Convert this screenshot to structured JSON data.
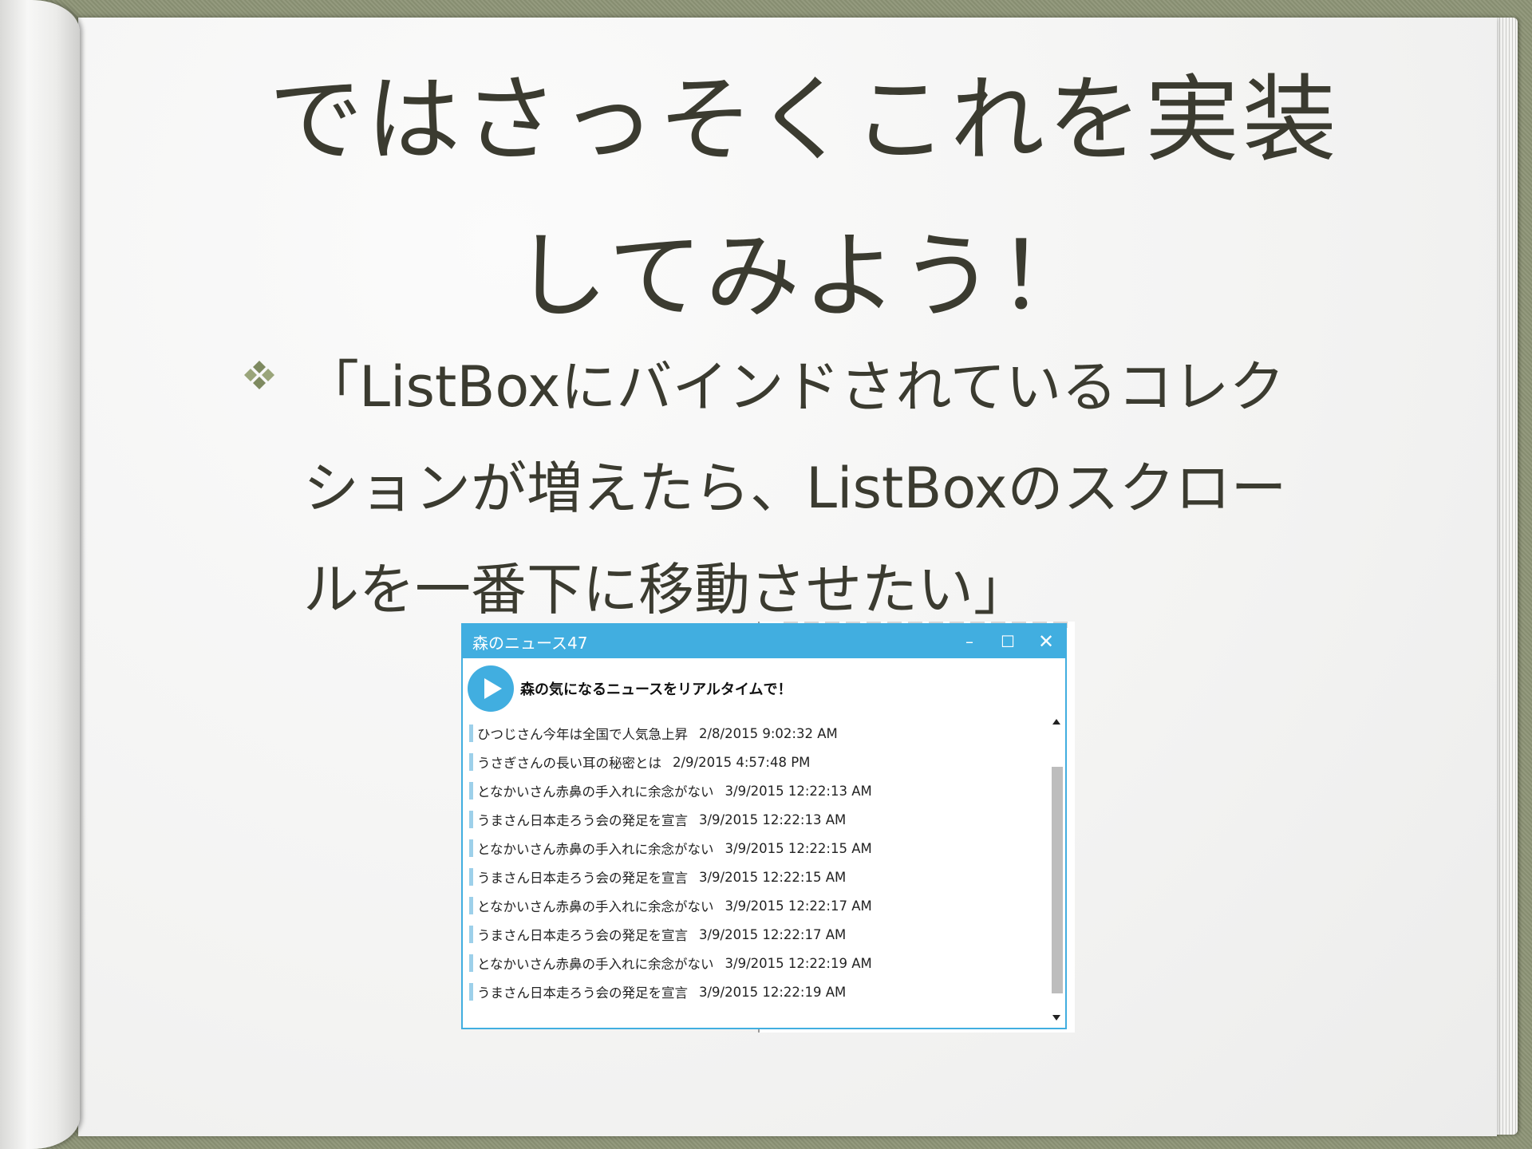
{
  "slide": {
    "title_line1": "ではさっそくこれを実装",
    "title_line2": "してみよう！",
    "bullet_line1": "「ListBoxにバインドされているコレク",
    "bullet_line2": "ションが増えたら、ListBoxのスクロー",
    "bullet_line3": "ルを一番下に移動させたい」"
  },
  "app": {
    "title": "森のニュース47",
    "controls": {
      "minimize": "–",
      "maximize": "☐",
      "close": "✕"
    },
    "header_text": "森の気になるニュースをリアルタイムで！",
    "accent_color": "#41aee0",
    "news_items": [
      {
        "text": "ひつじさん今年は全国で人気急上昇",
        "date": "2/8/2015 9:02:32 AM"
      },
      {
        "text": "うさぎさんの長い耳の秘密とは",
        "date": "2/9/2015 4:57:48 PM"
      },
      {
        "text": "となかいさん赤鼻の手入れに余念がない",
        "date": "3/9/2015 12:22:13 AM"
      },
      {
        "text": "うまさん日本走ろう会の発足を宣言",
        "date": "3/9/2015 12:22:13 AM"
      },
      {
        "text": "となかいさん赤鼻の手入れに余念がない",
        "date": "3/9/2015 12:22:15 AM"
      },
      {
        "text": "うまさん日本走ろう会の発足を宣言",
        "date": "3/9/2015 12:22:15 AM"
      },
      {
        "text": "となかいさん赤鼻の手入れに余念がない",
        "date": "3/9/2015 12:22:17 AM"
      },
      {
        "text": "うまさん日本走ろう会の発足を宣言",
        "date": "3/9/2015 12:22:17 AM"
      },
      {
        "text": "となかいさん赤鼻の手入れに余念がない",
        "date": "3/9/2015 12:22:19 AM"
      },
      {
        "text": "うまさん日本走ろう会の発足を宣言",
        "date": "3/9/2015 12:22:19 AM"
      }
    ]
  }
}
